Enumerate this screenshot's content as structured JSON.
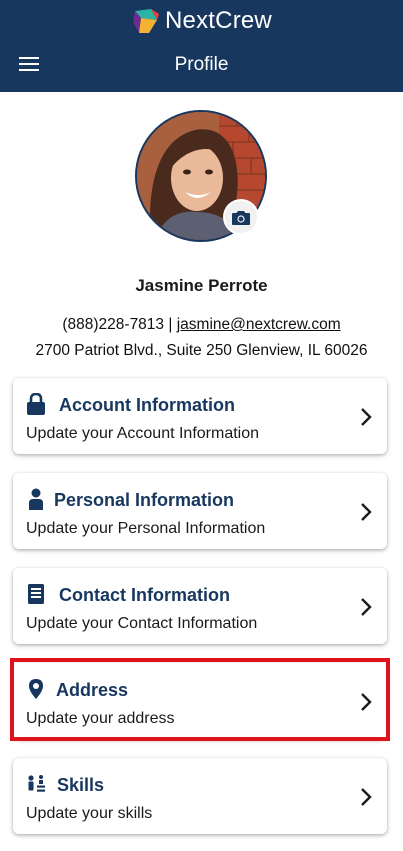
{
  "header": {
    "brand_name": "NextCrew",
    "page_title": "Profile",
    "background_color": "#17375e"
  },
  "profile": {
    "name": "Jasmine Perrote",
    "phone": "(888)228-7813",
    "separator": "|",
    "email": "jasmine@nextcrew.com",
    "address": "2700 Patriot Blvd., Suite 250 Glenview, IL 60026"
  },
  "cards": [
    {
      "icon": "lock-icon",
      "title": "Account Information",
      "subtitle": "Update your Account Information"
    },
    {
      "icon": "person-icon",
      "title": "Personal Information",
      "subtitle": "Update your Personal Information"
    },
    {
      "icon": "contact-book-icon",
      "title": "Contact Information",
      "subtitle": "Update your Contact Information"
    },
    {
      "icon": "map-pin-icon",
      "title": "Address",
      "subtitle": "Update your address"
    },
    {
      "icon": "skills-icon",
      "title": "Skills",
      "subtitle": "Update your skills"
    }
  ],
  "highlight_color": "#e0131b"
}
